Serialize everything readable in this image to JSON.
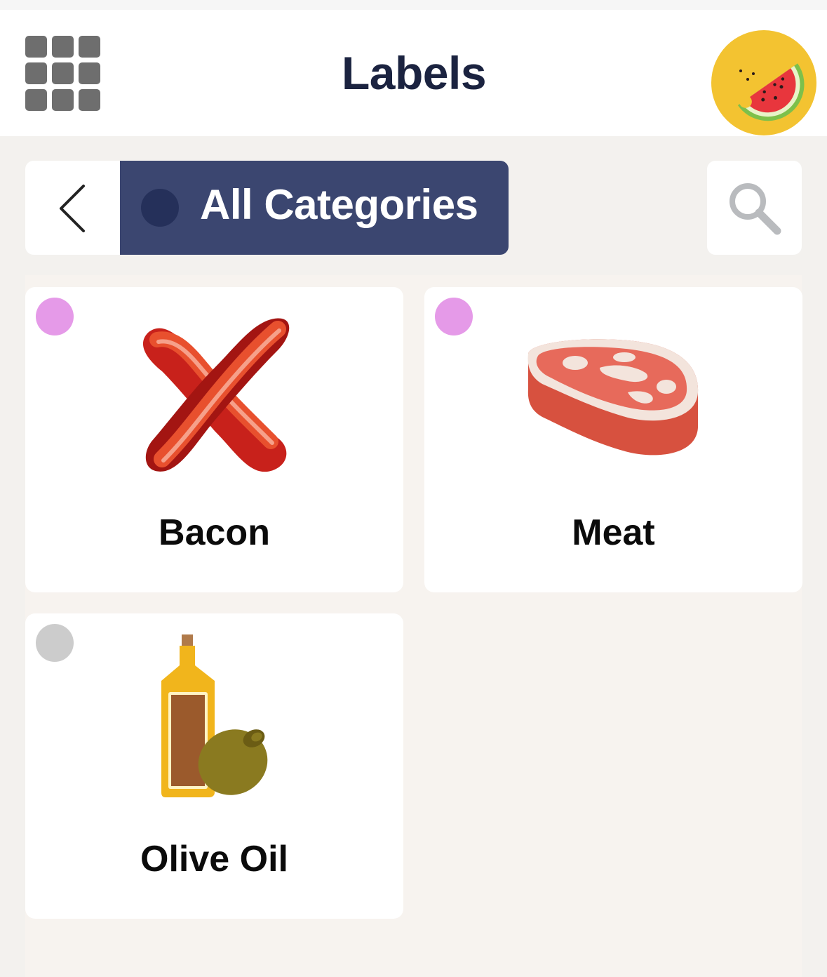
{
  "header": {
    "title": "Labels",
    "menu_icon": "grid-menu-icon",
    "avatar_icon": "watermelon-icon"
  },
  "toolbar": {
    "back_icon": "chevron-left-icon",
    "category_label": "All Categories",
    "search_icon": "search-icon"
  },
  "items": [
    {
      "label": "Bacon",
      "icon": "bacon-icon",
      "dot_color": "#e59ae8"
    },
    {
      "label": "Meat",
      "icon": "steak-icon",
      "dot_color": "#e59ae8"
    },
    {
      "label": "Olive Oil",
      "icon": "olive-oil-icon",
      "dot_color": "#cccccc"
    }
  ],
  "colors": {
    "header_bg": "#ffffff",
    "page_bg": "#f3f1ee",
    "pill_bg": "#3b4670",
    "title_color": "#1b2340",
    "avatar_bg": "#f3c331"
  }
}
